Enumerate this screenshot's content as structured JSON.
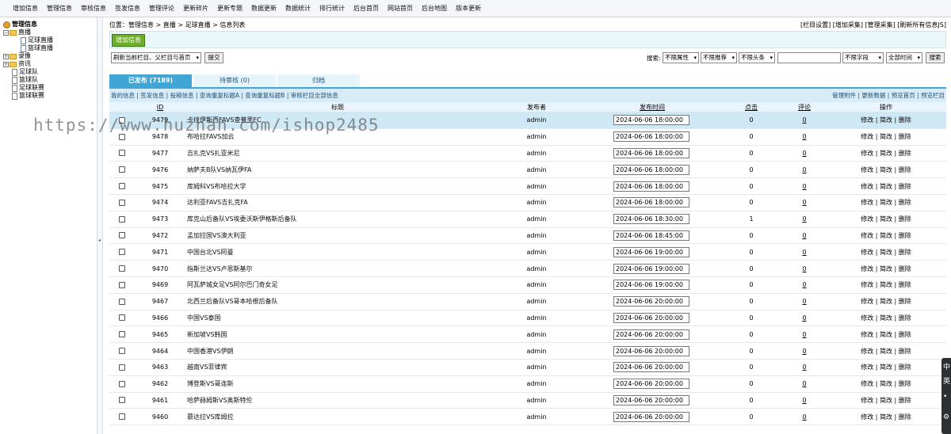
{
  "topnav": [
    "增加信息",
    "管理信息",
    "审核信息",
    "签发信息",
    "管理评论",
    "更新碎片",
    "更新专题",
    "数据更新",
    "数据统计",
    "排行统计",
    "后台首页",
    "网站首页",
    "后台地图",
    "版本更新"
  ],
  "sidebar": {
    "root": "管理信息",
    "items": [
      {
        "label": "直播",
        "icon": "minus-box-icon",
        "level": 0
      },
      {
        "label": "足球直播",
        "level": 2
      },
      {
        "label": "篮球直播",
        "level": 2
      },
      {
        "label": "录像",
        "icon": "plus-box-icon",
        "level": 0
      },
      {
        "label": "资讯",
        "icon": "plus-box-icon",
        "level": 0
      },
      {
        "label": "足球队",
        "level": 1
      },
      {
        "label": "篮球队",
        "level": 1
      },
      {
        "label": "足球联赛",
        "level": 1
      },
      {
        "label": "篮球联赛",
        "level": 1
      }
    ]
  },
  "breadcrumb": {
    "prefix": "位置：",
    "path": "管理信息 > 直播 > 足球直播 > 信息列表",
    "right": "[栏目设置] [增加采集] [管理采集] [刷新所有信息JS]"
  },
  "add_button": "增加信息",
  "filter": {
    "refresh_select": "刷新当前栏目、父栏目与首页",
    "submit": "提交",
    "search_label": "搜索:",
    "attr_select": "不限属性",
    "recommend_select": "不限推荐",
    "headline_select": "不限头条",
    "field_select": "不限字段",
    "time_select": "全部时间",
    "search_button": "搜索"
  },
  "tabs": [
    {
      "label": "已发布 (7189)",
      "active": true
    },
    {
      "label": "待审核 (0)",
      "active": false
    },
    {
      "label": "归档",
      "active": false
    }
  ],
  "sublinks": "我的信息 | 签发信息 | 投稿信息 | 查询重复标题A | 查询重复标题B | 审核栏目全部信息",
  "rightlinks": "管理附件 | 更新数据 | 预览首页 | 预览栏目",
  "table": {
    "headers": {
      "id": "ID",
      "title": "标题",
      "publisher": "发布者",
      "time": "发布时间",
      "clicks": "点击",
      "comments": "评论",
      "ops": "操作"
    },
    "rows": [
      {
        "id": "9479",
        "title": "卡拉伊斯西FAVS查普里FC",
        "publisher": "admin",
        "time": "2024-06-06 18:00:00",
        "clicks": "0",
        "comments": "0",
        "ops": "修改 | 简改 | 删除",
        "highlight": true
      },
      {
        "id": "9478",
        "title": "布哈拉FAVS加云",
        "publisher": "admin",
        "time": "2024-06-06 18:00:00",
        "clicks": "0",
        "comments": "0",
        "ops": "修改 | 简改 | 删除"
      },
      {
        "id": "9477",
        "title": "吉扎克VS扎亚米尼",
        "publisher": "admin",
        "time": "2024-06-06 18:00:00",
        "clicks": "0",
        "comments": "0",
        "ops": "修改 | 简改 | 删除"
      },
      {
        "id": "9476",
        "title": "纳萨夫B队VS纳瓦伊FA",
        "publisher": "admin",
        "time": "2024-06-06 18:00:00",
        "clicks": "0",
        "comments": "0",
        "ops": "修改 | 简改 | 删除"
      },
      {
        "id": "9475",
        "title": "库姆科VS布哈拉大学",
        "publisher": "admin",
        "time": "2024-06-06 18:00:00",
        "clicks": "0",
        "comments": "0",
        "ops": "修改 | 简改 | 删除"
      },
      {
        "id": "9474",
        "title": "达利亚FAVS吉扎克FA",
        "publisher": "admin",
        "time": "2024-06-06 18:00:00",
        "clicks": "0",
        "comments": "0",
        "ops": "修改 | 简改 | 删除"
      },
      {
        "id": "9473",
        "title": "库克山后备队VS埃委沃斯伊格斯后备队",
        "publisher": "admin",
        "time": "2024-06-06 18:30:00",
        "clicks": "1",
        "comments": "0",
        "ops": "修改 | 简改 | 删除"
      },
      {
        "id": "9472",
        "title": "孟加拉国VS澳大利亚",
        "publisher": "admin",
        "time": "2024-06-06 18:45:00",
        "clicks": "0",
        "comments": "0",
        "ops": "修改 | 简改 | 删除"
      },
      {
        "id": "9471",
        "title": "中国台北VS阿曼",
        "publisher": "admin",
        "time": "2024-06-06 19:00:00",
        "clicks": "0",
        "comments": "0",
        "ops": "修改 | 简改 | 删除"
      },
      {
        "id": "9470",
        "title": "指斯兰达VS卢恩斯基尔",
        "publisher": "admin",
        "time": "2024-06-06 19:00:00",
        "clicks": "0",
        "comments": "0",
        "ops": "修改 | 简改 | 删除"
      },
      {
        "id": "9469",
        "title": "阿瓦萨城女足VS阿尔巴门奇女足",
        "publisher": "admin",
        "time": "2024-06-06 19:00:00",
        "clicks": "0",
        "comments": "0",
        "ops": "修改 | 简改 | 删除"
      },
      {
        "id": "9467",
        "title": "北西兰后备队VS哥本哈根后备队",
        "publisher": "admin",
        "time": "2024-06-06 20:00:00",
        "clicks": "0",
        "comments": "0",
        "ops": "修改 | 简改 | 删除"
      },
      {
        "id": "9466",
        "title": "中国VS泰国",
        "publisher": "admin",
        "time": "2024-06-06 20:00:00",
        "clicks": "0",
        "comments": "0",
        "ops": "修改 | 简改 | 删除"
      },
      {
        "id": "9465",
        "title": "新加坡VS韩国",
        "publisher": "admin",
        "time": "2024-06-06 20:00:00",
        "clicks": "0",
        "comments": "0",
        "ops": "修改 | 简改 | 删除"
      },
      {
        "id": "9464",
        "title": "中国香港VS伊朗",
        "publisher": "admin",
        "time": "2024-06-06 20:00:00",
        "clicks": "0",
        "comments": "0",
        "ops": "修改 | 简改 | 删除"
      },
      {
        "id": "9463",
        "title": "越南VS菲律宾",
        "publisher": "admin",
        "time": "2024-06-06 20:00:00",
        "clicks": "0",
        "comments": "0",
        "ops": "修改 | 简改 | 删除"
      },
      {
        "id": "9462",
        "title": "博登斯VS哥连斯",
        "publisher": "admin",
        "time": "2024-06-06 20:00:00",
        "clicks": "0",
        "comments": "0",
        "ops": "修改 | 简改 | 删除"
      },
      {
        "id": "9461",
        "title": "哈萨赫姆斯VS奥斯特伦",
        "publisher": "admin",
        "time": "2024-06-06 20:00:00",
        "clicks": "0",
        "comments": "0",
        "ops": "修改 | 简改 | 删除"
      },
      {
        "id": "9460",
        "title": "慕达拉VS库姆拉",
        "publisher": "admin",
        "time": "2024-06-06 20:00:00",
        "clicks": "0",
        "comments": "0",
        "ops": "修改 | 简改 | 删除"
      }
    ]
  },
  "watermark": "https://www.huzhan.com/ishop2485",
  "side_widget": [
    "中",
    "英",
    "•",
    "⚙"
  ]
}
